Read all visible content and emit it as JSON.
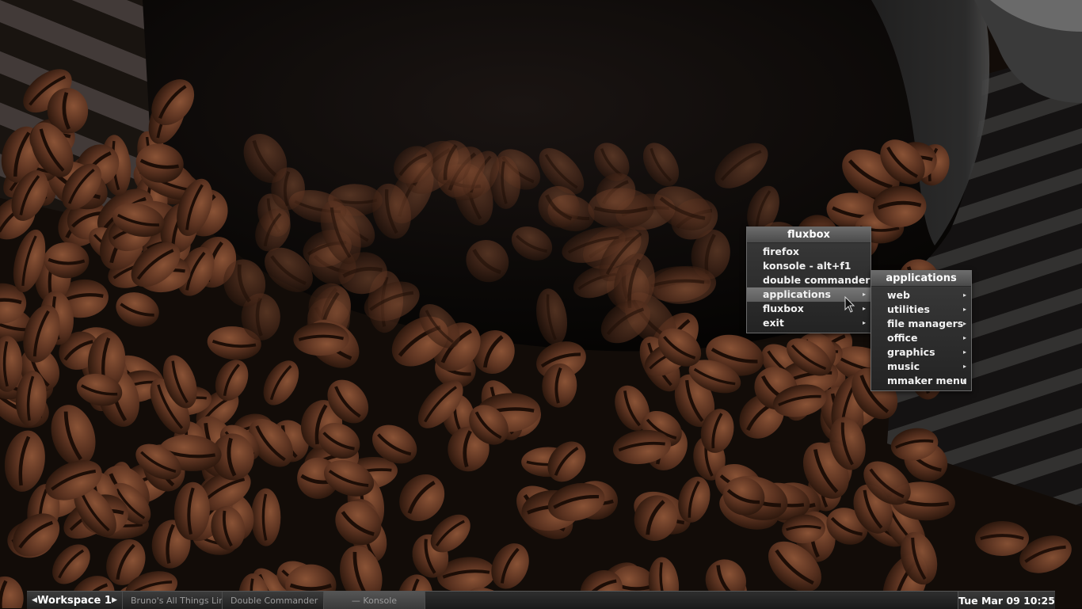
{
  "menus": {
    "root": {
      "title": "fluxbox",
      "items": [
        {
          "label": "firefox",
          "submenu": false,
          "active": false
        },
        {
          "label": "konsole - alt+f1",
          "submenu": false,
          "active": false
        },
        {
          "label": "double commander",
          "submenu": false,
          "active": false
        },
        {
          "label": "applications",
          "submenu": true,
          "active": true
        },
        {
          "label": "fluxbox",
          "submenu": true,
          "active": false
        },
        {
          "label": "exit",
          "submenu": true,
          "active": false
        }
      ]
    },
    "applications": {
      "title": "applications",
      "items": [
        {
          "label": "web",
          "submenu": true
        },
        {
          "label": "utilities",
          "submenu": true
        },
        {
          "label": "file managers",
          "submenu": true
        },
        {
          "label": "office",
          "submenu": true
        },
        {
          "label": "graphics",
          "submenu": true
        },
        {
          "label": "music",
          "submenu": true
        },
        {
          "label": "mmaker menu",
          "submenu": true
        }
      ]
    },
    "submenu_arrow_glyph": "▸"
  },
  "toolbar": {
    "prev_workspace_icon": "◀",
    "workspace_name": "Workspace 1",
    "next_workspace_icon": "▶",
    "tasks": [
      {
        "label": "Bruno's All Things Lin"
      },
      {
        "label": "Double Commander"
      },
      {
        "label": "— Konsole"
      }
    ],
    "clock": "Tue Mar 09   10:25"
  },
  "colors": {
    "menu_title_bg": "#5a5a5a",
    "menu_bg": "#2e2e2e",
    "menu_active_bg": "#6a6a6a",
    "toolbar_bg": "#2c2c2c",
    "wallpaper_dark": "#0f0a07",
    "bean_brown": "#5a3220"
  },
  "icons": {
    "submenu": "triangle-right-icon",
    "cursor": "arrow-cursor-icon"
  }
}
